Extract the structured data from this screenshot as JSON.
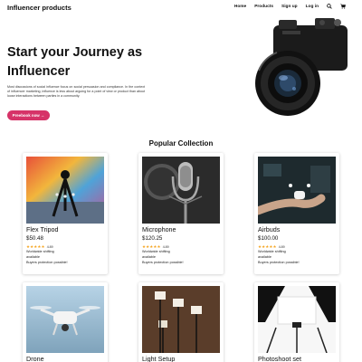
{
  "brand": "Influencer products",
  "nav": {
    "links": [
      "Home",
      "Products",
      "Sign up",
      "Log in"
    ],
    "icons": [
      "search-icon",
      "cart-icon"
    ]
  },
  "hero": {
    "title": "Start your Journey as Influencer",
    "description": "Most discussions of social influence focus on social persuasion and compliance. In the context of influencer marketing, influence is less about arguing for a point of view or product than about loose interactions between parties in a community.",
    "cta_label": "Preebook now",
    "cta_arrow": "→"
  },
  "section_title": "Popular Collection",
  "products": [
    {
      "name": "Flex Tripod",
      "price": "$50.48",
      "rating": "4.89",
      "stars": 5,
      "shipping": "Worldwide shifting",
      "availability": "available",
      "protection": "Buyers protection possible!"
    },
    {
      "name": "Microphone",
      "price": "$120.25",
      "rating": "4.89",
      "stars": 5,
      "shipping": "Worldwide shifting",
      "availability": "available",
      "protection": "Buyers protection possible!"
    },
    {
      "name": "Airbuds",
      "price": "$100.00",
      "rating": "4.89",
      "stars": 5,
      "shipping": "Worldwide shifting",
      "availability": "available",
      "protection": "Buyers protection possible!"
    },
    {
      "name": "Drone",
      "price": "",
      "rating": "",
      "stars": 0,
      "shipping": "",
      "availability": "",
      "protection": ""
    },
    {
      "name": "Light Setup",
      "price": "",
      "rating": "",
      "stars": 0,
      "shipping": "",
      "availability": "",
      "protection": ""
    },
    {
      "name": "Photoshoot set",
      "price": "",
      "rating": "",
      "stars": 0,
      "shipping": "",
      "availability": "",
      "protection": ""
    }
  ],
  "colors": {
    "accent": "#d63368",
    "stars": "#f5a623"
  }
}
